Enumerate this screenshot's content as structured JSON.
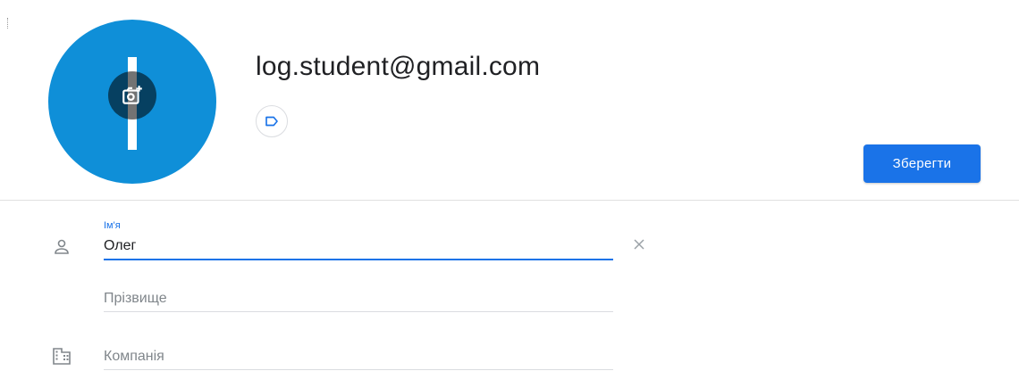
{
  "profile": {
    "email": "log.student@gmail.com",
    "avatar_color": "#0f8fd8"
  },
  "toolbar": {
    "save_label": "Зберегти"
  },
  "form": {
    "first_name": {
      "label": "Ім'я",
      "value": "Олег"
    },
    "last_name": {
      "placeholder": "Прізвище"
    },
    "company": {
      "placeholder": "Компанія"
    }
  },
  "icons": {
    "avatar_action": "add-photo-icon",
    "label": "label-outline-icon",
    "name_row": "person-icon",
    "company_row": "business-icon",
    "clear": "close-icon"
  },
  "colors": {
    "accent": "#1a73e8",
    "avatar": "#0f8fd8",
    "divider": "#e0e0e0",
    "muted": "#80868b"
  }
}
